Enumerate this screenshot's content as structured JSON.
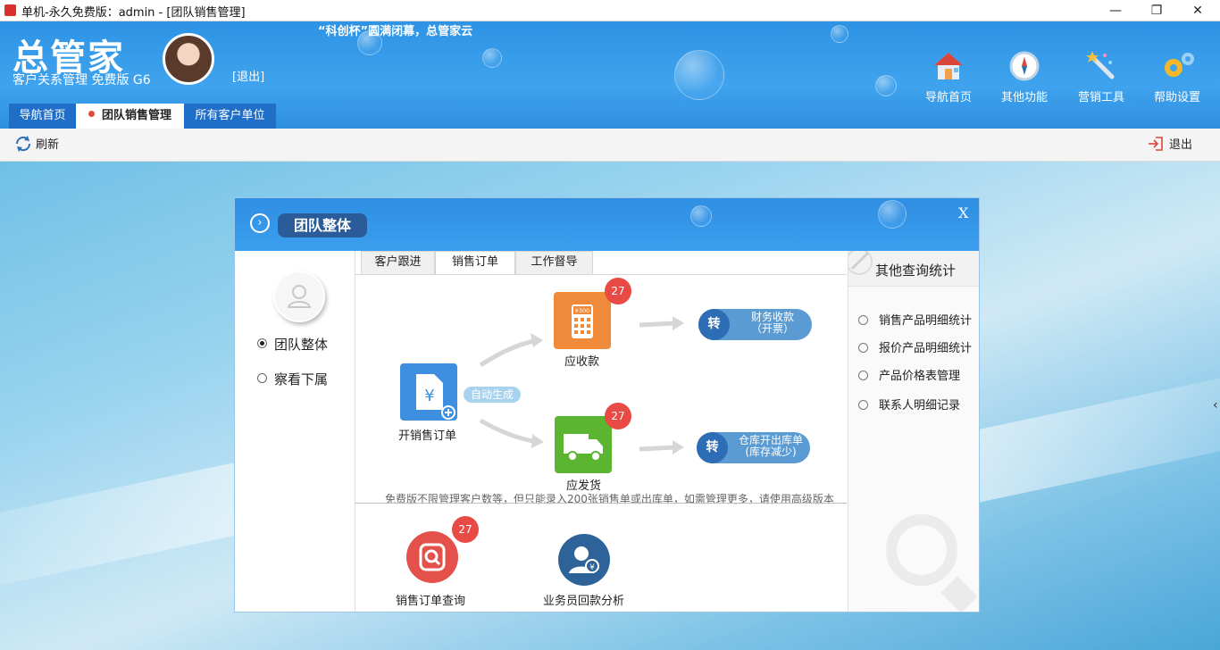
{
  "window": {
    "title": "单机-永久免费版：admin - [团队销售管理]"
  },
  "header": {
    "logo": "总管家",
    "subtitle": "客户关系管理 免费版 G6",
    "logout": "[退出]",
    "slogan": "“科创杯”圆满闭幕，总管家云",
    "nav": [
      {
        "label": "导航首页",
        "icon": "home-icon"
      },
      {
        "label": "其他功能",
        "icon": "compass-icon"
      },
      {
        "label": "营销工具",
        "icon": "magic-wand-icon"
      },
      {
        "label": "帮助设置",
        "icon": "gears-icon"
      }
    ],
    "tabs": [
      {
        "label": "导航首页",
        "active": false
      },
      {
        "label": "团队销售管理",
        "active": true
      },
      {
        "label": "所有客户单位",
        "active": false
      }
    ]
  },
  "toolbar": {
    "refresh": "刷新",
    "exit": "退出"
  },
  "dialog": {
    "title": "团队整体",
    "close": "X",
    "left": {
      "options": [
        {
          "label": "团队整体",
          "checked": true
        },
        {
          "label": "察看下属",
          "checked": false
        }
      ]
    },
    "subtabs": [
      {
        "label": "客户跟进",
        "active": false
      },
      {
        "label": "销售订单",
        "active": true
      },
      {
        "label": "工作督导",
        "active": false
      }
    ],
    "flow": {
      "start_label": "开销售订单",
      "auto_label": "自动生成",
      "receivable_label": "应收款",
      "receivable_badge": "27",
      "receivable_price": "¥300",
      "ship_label": "应发货",
      "ship_badge": "27",
      "turn1_zh": "转",
      "turn1_line1": "财务收款",
      "turn1_line2": "（开票）",
      "turn2_zh": "转",
      "turn2_line1": "仓库开出库单",
      "turn2_line2": "(库存减少)"
    },
    "note": "免费版不限管理客户数等，但只能录入200张销售单或出库单，如需管理更多，请使用高级版本",
    "bottom": [
      {
        "label": "销售订单查询",
        "badge": "27"
      },
      {
        "label": "业务员回款分析"
      }
    ],
    "right": {
      "title": "其他查询统计",
      "items": [
        "销售产品明细统计",
        "报价产品明细统计",
        "产品价格表管理",
        "联系人明细记录"
      ]
    }
  },
  "colors": {
    "header_blue": "#2e93e4",
    "tab_blue": "#1f6ec8",
    "badge_red": "#e84b45",
    "orange": "#ef8a3a",
    "green": "#5cb531"
  }
}
